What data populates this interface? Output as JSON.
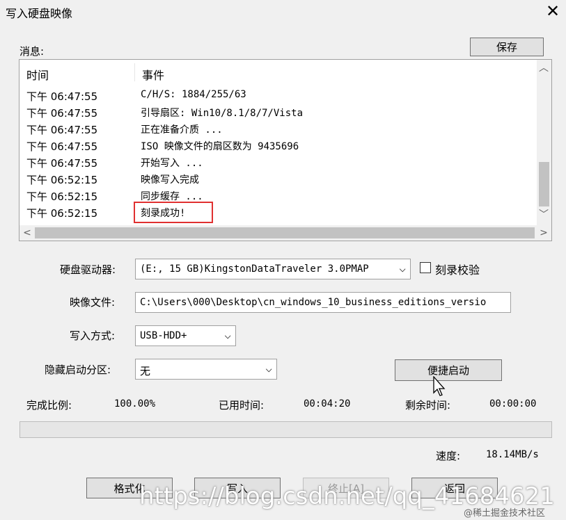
{
  "window": {
    "title": "写入硬盘映像",
    "close_glyph": "✕"
  },
  "messages": {
    "label": "消息:",
    "save_button": "保存",
    "headers": {
      "time": "时间",
      "event": "事件"
    },
    "rows": [
      {
        "time": "下午 06:47:55",
        "event": "C/H/S: 1884/255/63"
      },
      {
        "time": "下午 06:47:55",
        "event": "引导扇区: Win10/8.1/8/7/Vista"
      },
      {
        "time": "下午 06:47:55",
        "event": "正在准备介质 ..."
      },
      {
        "time": "下午 06:47:55",
        "event": "ISO 映像文件的扇区数为 9435696"
      },
      {
        "time": "下午 06:47:55",
        "event": "开始写入 ..."
      },
      {
        "time": "下午 06:52:15",
        "event": "映像写入完成"
      },
      {
        "time": "下午 06:52:15",
        "event": "同步缓存 ..."
      },
      {
        "time": "下午 06:52:15",
        "event": "刻录成功!"
      }
    ]
  },
  "form": {
    "drive_label": "硬盘驱动器:",
    "drive_value": "(E:, 15 GB)KingstonDataTraveler 3.0PMAP",
    "verify_label": "刻录校验",
    "image_label": "映像文件:",
    "image_value": "C:\\Users\\000\\Desktop\\cn_windows_10_business_editions_versio",
    "method_label": "写入方式:",
    "method_value": "USB-HDD+",
    "hidden_label": "隐藏启动分区:",
    "hidden_value": "无",
    "quick_boot_button": "便捷启动"
  },
  "status": {
    "percent_label": "完成比例:",
    "percent_value": "100.00%",
    "elapsed_label": "已用时间:",
    "elapsed_value": "00:04:20",
    "remaining_label": "剩余时间:",
    "remaining_value": "00:00:00",
    "progress_fraction": 1.0,
    "speed_label": "速度:",
    "speed_value": "18.14MB/s"
  },
  "buttons": {
    "format": "格式化",
    "write": "写入",
    "abort": "终止[A]",
    "back": "返回"
  },
  "watermark": {
    "url": "https://blog.csdn.net/qq_41684621",
    "source": "@稀土掘金技术社区"
  },
  "colors": {
    "highlight_border": "#e03030",
    "scroll_thumb": "#c2c2c2"
  }
}
